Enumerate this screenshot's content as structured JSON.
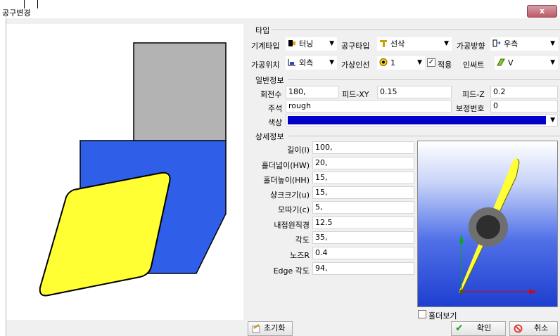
{
  "window": {
    "title": "공구변경",
    "close_label": "x"
  },
  "colors": {
    "tool_body": "#2f5fe8",
    "holder": "#b3b3b3",
    "insert": "#ffff33",
    "color_swatch": "#0000c8",
    "preview_bg_top": "#ffffff",
    "preview_bg_bottom": "#1e3fd0"
  },
  "type_section": {
    "heading": "타입",
    "machine_type": {
      "label": "기계타입",
      "value": "터닝",
      "icon": "lathe-icon"
    },
    "tool_type": {
      "label": "공구타입",
      "value": "선삭",
      "icon": "turning-tool-icon"
    },
    "machining_direction": {
      "label": "가공방향",
      "value": "우측",
      "icon": "right-direction-icon"
    },
    "machining_position": {
      "label": "가공위치",
      "value": "외측",
      "icon": "outer-position-icon"
    },
    "virtual_insert": {
      "label": "가상인선",
      "value": "1",
      "icon": "virtual-insert-icon"
    },
    "apply": {
      "label": "적용",
      "checked": true
    },
    "insert": {
      "label": "인써트",
      "value": "V",
      "icon": "insert-icon"
    }
  },
  "general_section": {
    "heading": "일반정보",
    "rpm": {
      "label": "회전수",
      "value": "180,"
    },
    "feed_xy": {
      "label": "피드-XY",
      "value": "0.15"
    },
    "feed_z": {
      "label": "피드-Z",
      "value": "0.2"
    },
    "comment": {
      "label": "주석",
      "value": "rough"
    },
    "offset_no": {
      "label": "보정번호",
      "value": "0"
    },
    "color": {
      "label": "색상"
    }
  },
  "detail_section": {
    "heading": "상세정보",
    "fields": [
      {
        "label": "길이(l)",
        "value": "100,"
      },
      {
        "label": "홀더넓이(HW)",
        "value": "20,"
      },
      {
        "label": "홀더높이(HH)",
        "value": "15,"
      },
      {
        "label": "샹크크기(u)",
        "value": "15,"
      },
      {
        "label": "모따기(c)",
        "value": "5,"
      },
      {
        "label": "내접원직경",
        "value": "12.5"
      },
      {
        "label": "각도",
        "value": "35,"
      },
      {
        "label": "노즈R",
        "value": "0.4"
      },
      {
        "label": "Edge 각도",
        "value": "94,"
      }
    ],
    "holder_view": {
      "label": "홀더보기",
      "checked": false
    }
  },
  "footer": {
    "reset_label": "초기화",
    "ok_label": "확인",
    "cancel_label": "취소"
  }
}
